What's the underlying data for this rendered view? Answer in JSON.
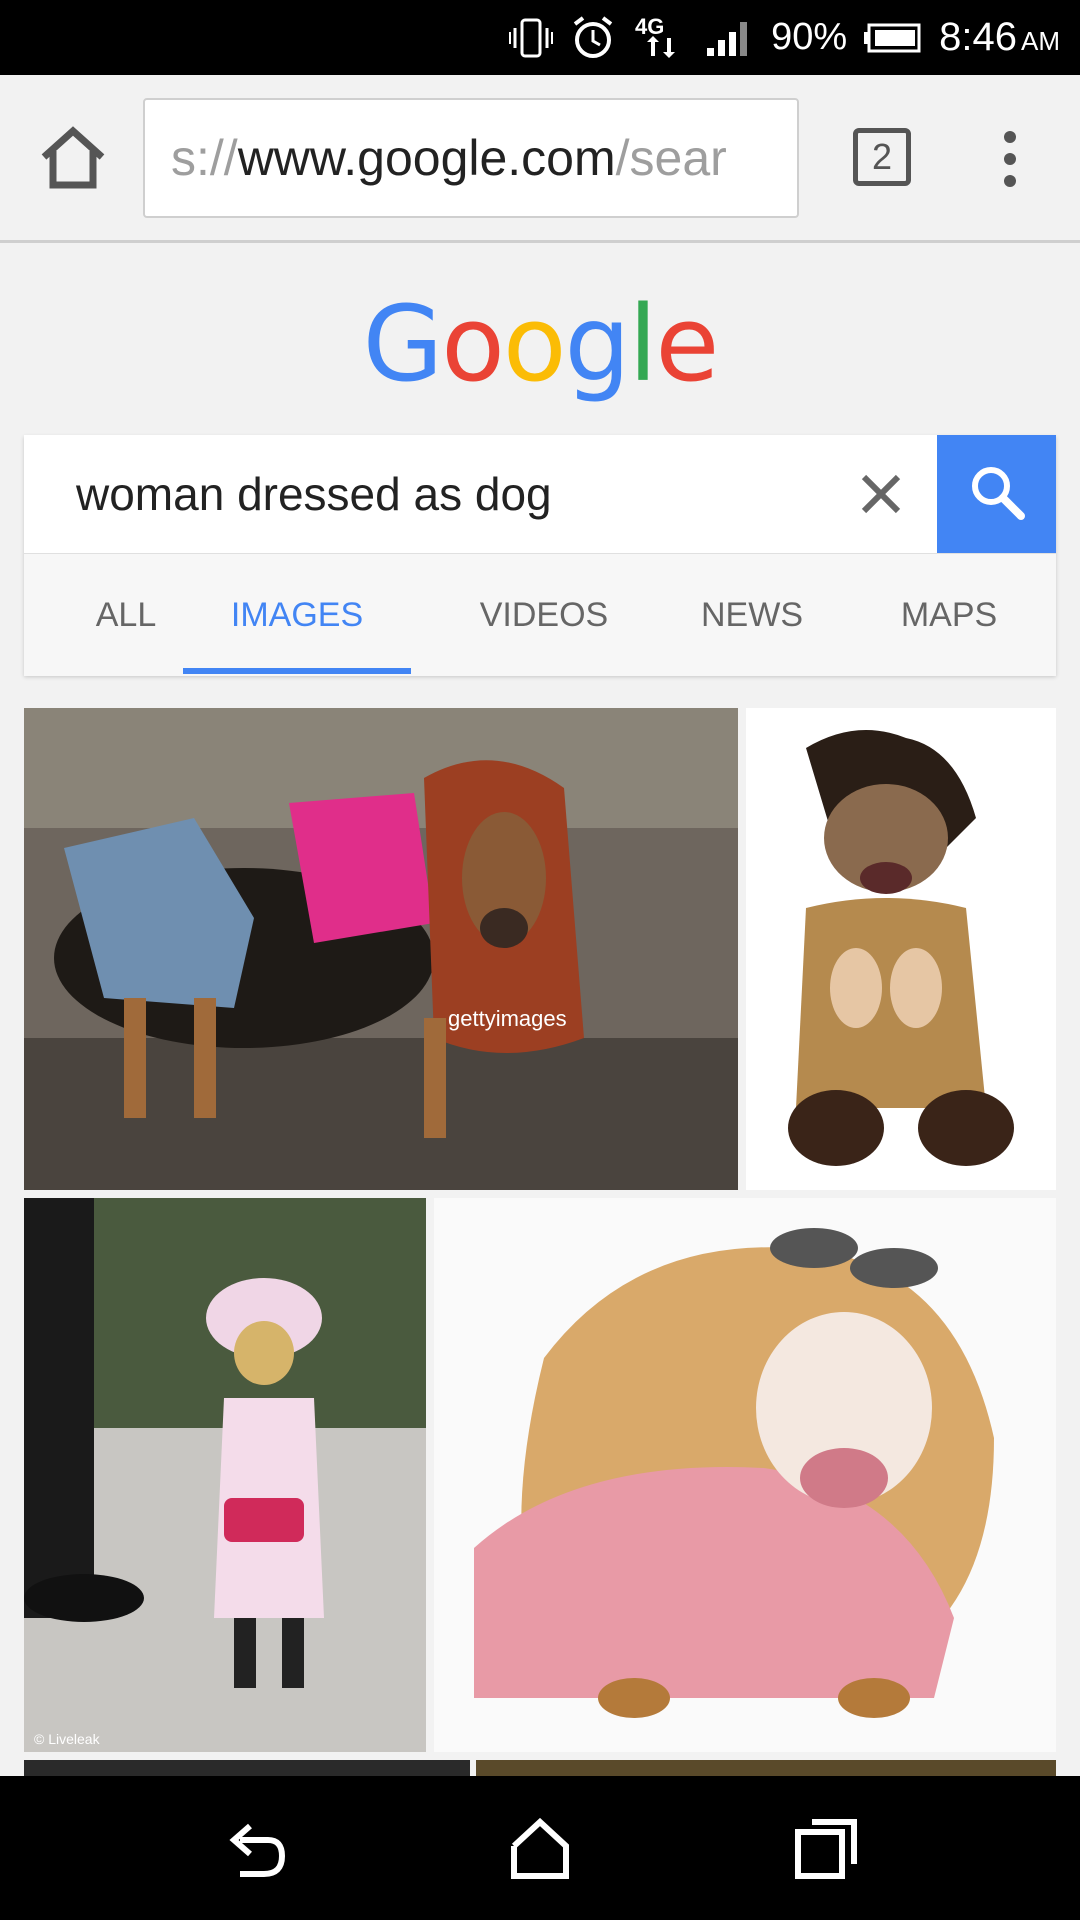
{
  "status_bar": {
    "network": "4G",
    "battery": "90%",
    "time": "8:46",
    "ampm": "AM"
  },
  "browser": {
    "url_prefix": "s://",
    "url_host": "www.google.com",
    "url_path": "/sear",
    "tab_count": "2"
  },
  "google_logo": [
    "G",
    "o",
    "o",
    "g",
    "l",
    "e"
  ],
  "logo_colors": [
    "#4285f4",
    "#ea4335",
    "#fbbc05",
    "#4285f4",
    "#34a853",
    "#ea4335"
  ],
  "search": {
    "query": "woman dressed as dog"
  },
  "tabs": [
    "ALL",
    "IMAGES",
    "VIDEOS",
    "NEWS",
    "MAPS"
  ],
  "active_tab": "IMAGES",
  "accent_color": "#4285f4",
  "results": [
    {
      "watermark": "gettyimages"
    },
    {
      "watermark": ""
    },
    {
      "watermark": "© Liveleak"
    },
    {
      "watermark": ""
    }
  ]
}
